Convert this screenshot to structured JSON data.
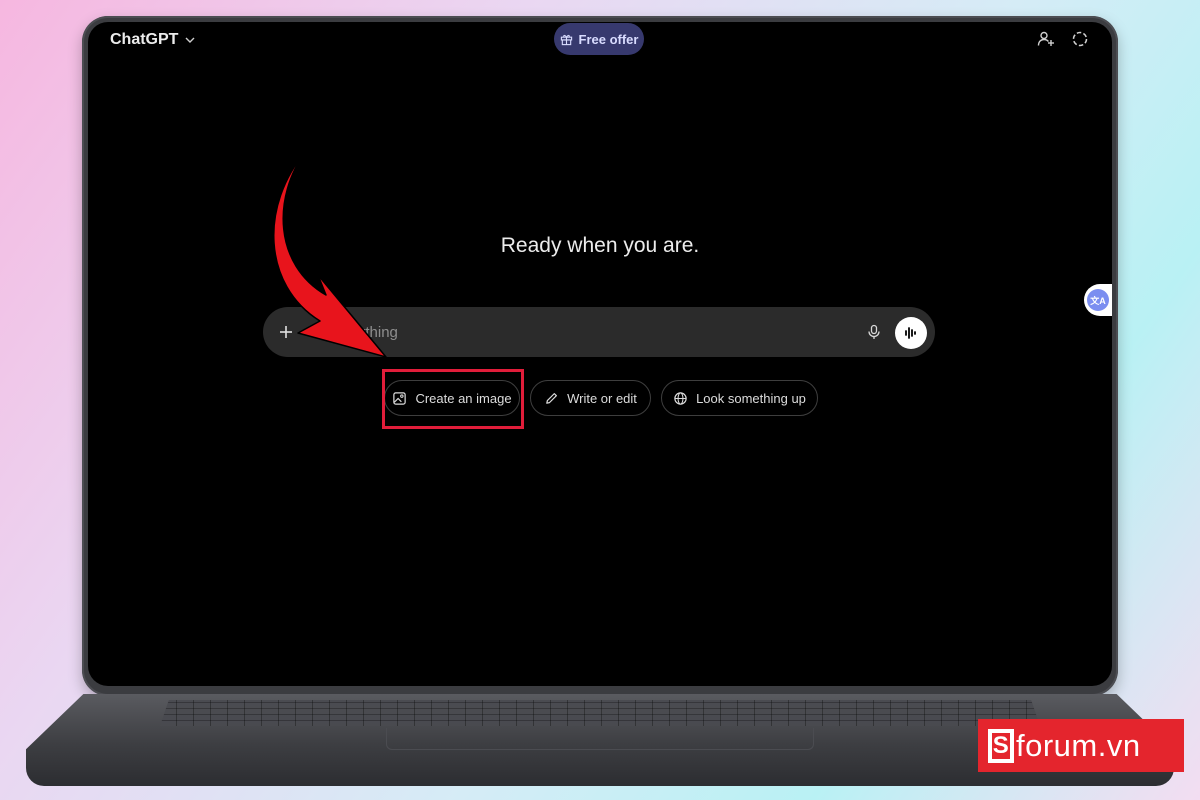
{
  "header": {
    "app_title": "ChatGPT",
    "free_offer_label": "Free offer"
  },
  "main": {
    "heading": "Ready when you are.",
    "composer_placeholder": "Ask anything"
  },
  "suggestions": [
    {
      "label": "Create an image",
      "icon": "image-icon"
    },
    {
      "label": "Write or edit",
      "icon": "pencil-icon"
    },
    {
      "label": "Look something up",
      "icon": "globe-icon"
    }
  ],
  "translate_widget_label": "文A",
  "logo": {
    "text": "forum.vn"
  },
  "colors": {
    "accent_red": "#e11d3a",
    "offer_bg": "#37396e",
    "logo_red": "#e4252d"
  }
}
